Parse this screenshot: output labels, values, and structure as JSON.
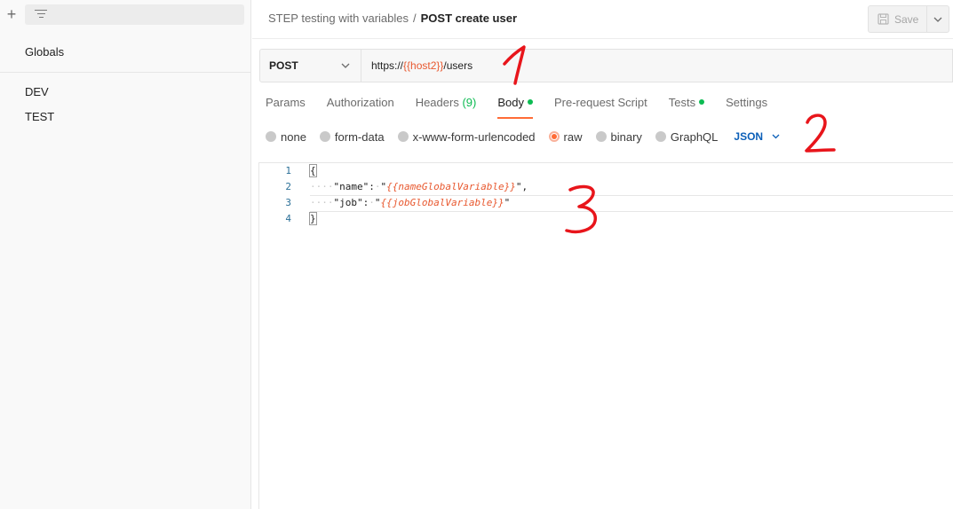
{
  "sidebar": {
    "new_icon": "plus-icon",
    "filter_icon": "filter-icon",
    "globals_label": "Globals",
    "environments": [
      {
        "label": "DEV"
      },
      {
        "label": "TEST"
      }
    ]
  },
  "header": {
    "collection": "STEP testing with variables",
    "separator": "/",
    "request_name": "POST create user",
    "save_label": "Save"
  },
  "request": {
    "method": "POST",
    "url_prefix": "https://",
    "url_variable": "{{host2}}",
    "url_suffix": "/users"
  },
  "tabs": [
    {
      "label": "Params"
    },
    {
      "label": "Authorization"
    },
    {
      "label": "Headers",
      "count": "(9)"
    },
    {
      "label": "Body",
      "active": true,
      "dot": true
    },
    {
      "label": "Pre-request Script"
    },
    {
      "label": "Tests",
      "dot": true
    },
    {
      "label": "Settings"
    }
  ],
  "body_options": {
    "items": [
      {
        "label": "none"
      },
      {
        "label": "form-data"
      },
      {
        "label": "x-www-form-urlencoded"
      },
      {
        "label": "raw",
        "selected": true
      },
      {
        "label": "binary"
      },
      {
        "label": "GraphQL"
      }
    ],
    "format": "JSON"
  },
  "editor": {
    "line_numbers": [
      "1",
      "2",
      "3",
      "4"
    ],
    "line1": "{",
    "line2_key": "\"name\"",
    "line2_colon": ":",
    "line2_quote_open": "\"",
    "line2_value": "{{nameGlobalVariable}}",
    "line2_quote_close": "\",",
    "line3_key": "\"job\"",
    "line3_colon": ":",
    "line3_quote_open": "\"",
    "line3_value": "{{jobGlobalVariable}}",
    "line3_quote_close": "\"",
    "line4": "}"
  },
  "annotations": {
    "one": "1",
    "two": "2",
    "three": "3",
    "color": "#e8151b"
  },
  "colors": {
    "accent": "#ff6c37",
    "variable": "#e8582f",
    "success_dot": "#0cbb52",
    "json_blue": "#0b5fb8"
  }
}
